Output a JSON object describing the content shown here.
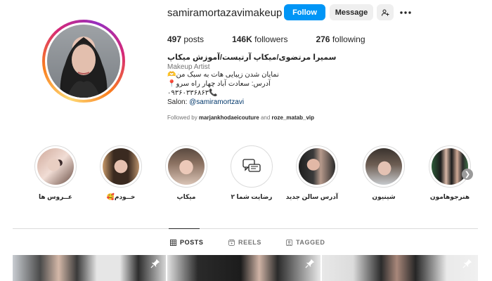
{
  "profile": {
    "username": "samiramortazavimakeup",
    "follow_label": "Follow",
    "message_label": "Message",
    "stats": [
      {
        "count": "497",
        "label": "posts"
      },
      {
        "count": "146K",
        "label": "followers"
      },
      {
        "count": "276",
        "label": "following"
      }
    ],
    "full_name": "سمیرا مرتضوی/میکاپ آرتیست/آموزش میکاپ",
    "category": "Makeup Artist",
    "bio_lines": [
      "نمایان شدن زیبایی هات به سبک من🫶",
      "آدرس: سعادت آباد چهار راه سرو📍",
      "۰۹۳۶۰۳۳۶۸۶۳📞"
    ],
    "salon_prefix": "Salon: ",
    "salon_handle": "@samiramortzavi",
    "followed_by_prefix": "Followed by ",
    "followed_by_user1": "marjankhodaeicouture",
    "followed_by_and": " and ",
    "followed_by_user2": "roze_matab_vip"
  },
  "highlights": [
    {
      "label": "عــروس ها"
    },
    {
      "label": "خــودم🥰"
    },
    {
      "label": "میکاپ"
    },
    {
      "label": "رضایت شما ۲"
    },
    {
      "label": "آدرس سالن جدید"
    },
    {
      "label": "شینیون"
    },
    {
      "label": "هنرجوهامون"
    }
  ],
  "tabs": {
    "posts": "POSTS",
    "reels": "REELS",
    "tagged": "TAGGED"
  },
  "colors": {
    "follow_button": "#0095f6",
    "secondary_button": "#efefef",
    "link": "#00376b",
    "muted_text": "#737373"
  }
}
